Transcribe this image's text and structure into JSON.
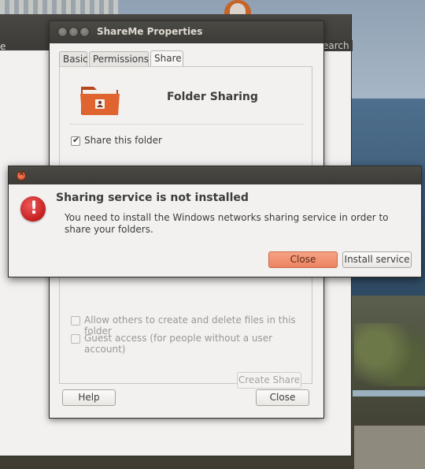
{
  "background_app": {
    "left_fragment": "e",
    "right_fragment": "earch"
  },
  "properties_window": {
    "title": "ShareMe Properties",
    "tabs": [
      {
        "label": "Basic"
      },
      {
        "label": "Permissions"
      },
      {
        "label": "Share",
        "active": true
      }
    ],
    "heading": "Folder Sharing",
    "share_this_folder": {
      "label": "Share this folder",
      "checked": true
    },
    "allow_others": {
      "label": "Allow others to create and delete files in this folder",
      "checked": false,
      "enabled": false
    },
    "guest_access": {
      "label": "Guest access (for people without a user account)",
      "checked": false,
      "enabled": false
    },
    "create_share_label": "Create Share",
    "help_label": "Help",
    "close_label": "Close"
  },
  "alert_dialog": {
    "heading": "Sharing service is not installed",
    "message": "You need to install the Windows networks sharing service in order to share your folders.",
    "close_label": "Close",
    "install_label": "Install service",
    "icon": "error-icon"
  },
  "colors": {
    "titlebar": "#3c3b37",
    "primary_button": "#ec8461",
    "error_icon": "#c41f1f",
    "folder_icon": "#e0642f"
  }
}
